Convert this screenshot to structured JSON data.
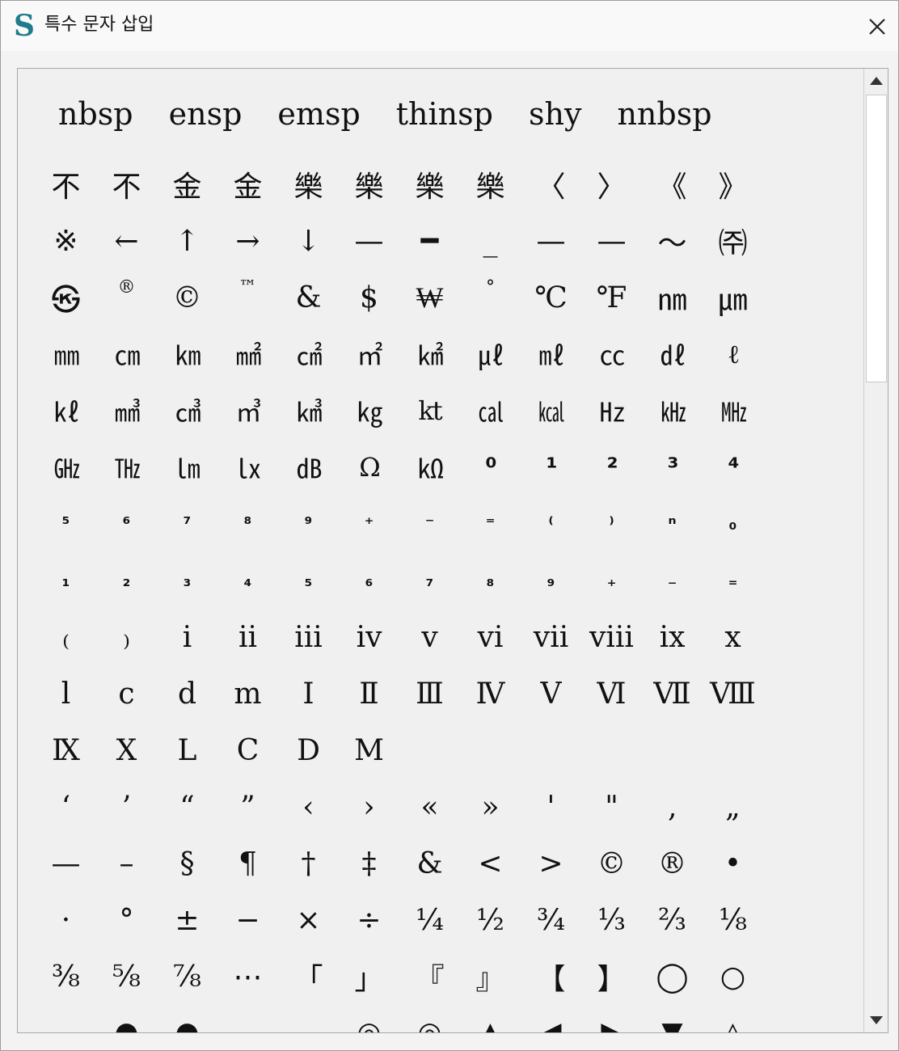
{
  "window": {
    "title": "특수 문자 삽입",
    "logo": "S",
    "close_icon": "close-icon"
  },
  "spaces": [
    "nbsp",
    "ensp",
    "emsp",
    "thinsp",
    "shy",
    "nnbsp"
  ],
  "rows": [
    [
      "不",
      "不",
      "金",
      "金",
      "樂",
      "樂",
      "樂",
      "樂",
      "〈",
      "〉",
      "《",
      "》"
    ],
    [
      "※",
      "←",
      "↑",
      "→",
      "↓",
      "—",
      "━",
      "_",
      "—",
      "—",
      "～",
      "㈜"
    ],
    [
      "㉿",
      "®",
      "©",
      "™",
      "&",
      "$",
      "₩",
      "°",
      "℃",
      "℉",
      "㎚",
      "㎛"
    ],
    [
      "㎜",
      "㎝",
      "㎞",
      "㎟",
      "㎠",
      "㎡",
      "㎢",
      "㎕",
      "㎖",
      "㏄",
      "㎗",
      "ℓ"
    ],
    [
      "㎘",
      "㎣",
      "㎤",
      "㎥",
      "㎦",
      "㎏",
      "kt",
      "㎈",
      "㎉",
      "㎐",
      "㎑",
      "㎒"
    ],
    [
      "㎓",
      "㎔",
      "㏐",
      "㏓",
      "㏈",
      "Ω",
      "㏀",
      "⁰",
      "¹",
      "²",
      "³",
      "⁴"
    ],
    [
      "⁵",
      "⁶",
      "⁷",
      "⁸",
      "⁹",
      "⁺",
      "⁻",
      "⁼",
      "⁽",
      "⁾",
      "ⁿ",
      "₀"
    ],
    [
      "₁",
      "₂",
      "₃",
      "₄",
      "₅",
      "₆",
      "₇",
      "₈",
      "₉",
      "₊",
      "₋",
      "₌"
    ],
    [
      "₍",
      "₎",
      "ⅰ",
      "ⅱ",
      "ⅲ",
      "ⅳ",
      "ⅴ",
      "ⅵ",
      "ⅶ",
      "ⅷ",
      "ⅸ",
      "ⅹ"
    ],
    [
      "ⅼ",
      "ⅽ",
      "ⅾ",
      "ⅿ",
      "Ⅰ",
      "Ⅱ",
      "Ⅲ",
      "Ⅳ",
      "Ⅴ",
      "Ⅵ",
      "Ⅶ",
      "Ⅷ"
    ],
    [
      "Ⅸ",
      "Ⅹ",
      "Ⅼ",
      "Ⅽ",
      "Ⅾ",
      "Ⅿ",
      "",
      "",
      "",
      "",
      "",
      ""
    ],
    [
      "‘",
      "’",
      "“",
      "”",
      "‹",
      "›",
      "«",
      "»",
      "'",
      "\"",
      "‚",
      "„"
    ],
    [
      "—",
      "–",
      "§",
      "¶",
      "†",
      "‡",
      "&",
      "<",
      ">",
      "©",
      "®",
      "•"
    ],
    [
      "·",
      "°",
      "±",
      "−",
      "×",
      "÷",
      "¼",
      "½",
      "¾",
      "⅓",
      "⅔",
      "⅛"
    ],
    [
      "⅜",
      "⅝",
      "⅞",
      "⋯",
      "「",
      "」",
      "『",
      "』",
      "【",
      "】",
      "◯",
      "○"
    ]
  ],
  "partial_row": [
    "",
    "●",
    "●",
    "",
    "",
    "◎",
    "◎",
    "▲",
    "◀",
    "▶",
    "▼",
    "△"
  ],
  "scrollbar": {
    "up_icon": "scroll-up-arrow-icon",
    "down_icon": "scroll-down-arrow-icon"
  }
}
